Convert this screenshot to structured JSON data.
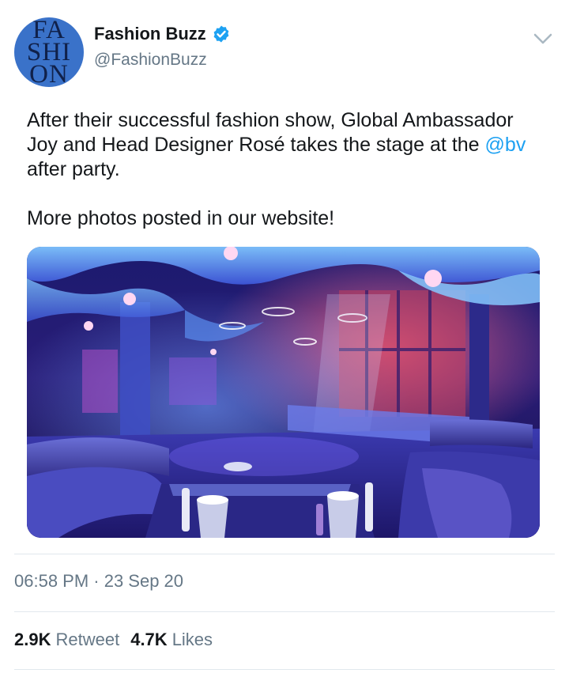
{
  "tweet": {
    "author": {
      "display_name": "Fashion Buzz",
      "handle": "@FashionBuzz",
      "verified": true,
      "avatar_text": [
        "FA",
        "SHI",
        "ON"
      ]
    },
    "menu_icon": "chevron-down-icon",
    "text": {
      "line1_before": "After their successful fashion show, Global Ambassador Joy and Head Designer Rosé takes the stage at the ",
      "mention": "@bv",
      "line1_after": " after party.",
      "line2": "More photos posted in our website!"
    },
    "media": {
      "type": "photo",
      "icon": "nightclub-photo"
    },
    "timestamp": "06:58 PM · 23 Sep 20",
    "stats": {
      "retweets_count": "2.9K",
      "retweets_label": "Retweet",
      "likes_count": "4.7K",
      "likes_label": "Likes"
    },
    "colors": {
      "accent": "#1da1f2",
      "secondary_text": "#657786",
      "divider": "#e1e8ed",
      "avatar_bg": "#3a72c9"
    }
  }
}
